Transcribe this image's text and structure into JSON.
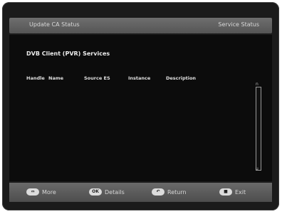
{
  "header": {
    "left_label": "Update CA Status",
    "right_label": "Service Status"
  },
  "panel": {
    "title": "DVB Client (PVR) Services",
    "columns": [
      "Handle",
      "Name",
      "Source ES",
      "Instance",
      "Description"
    ]
  },
  "scroll": {
    "top_marker": "n",
    "bottom_marker": "u"
  },
  "footer": {
    "keys": [
      {
        "key": "⇔",
        "label": "More",
        "icon": "arrows-key-icon"
      },
      {
        "key": "OK",
        "label": "Details",
        "icon": "ok-key-icon"
      },
      {
        "key": "↶",
        "label": "Return",
        "icon": "return-key-icon"
      },
      {
        "key": "■",
        "label": "Exit",
        "icon": "exit-key-icon"
      }
    ]
  }
}
